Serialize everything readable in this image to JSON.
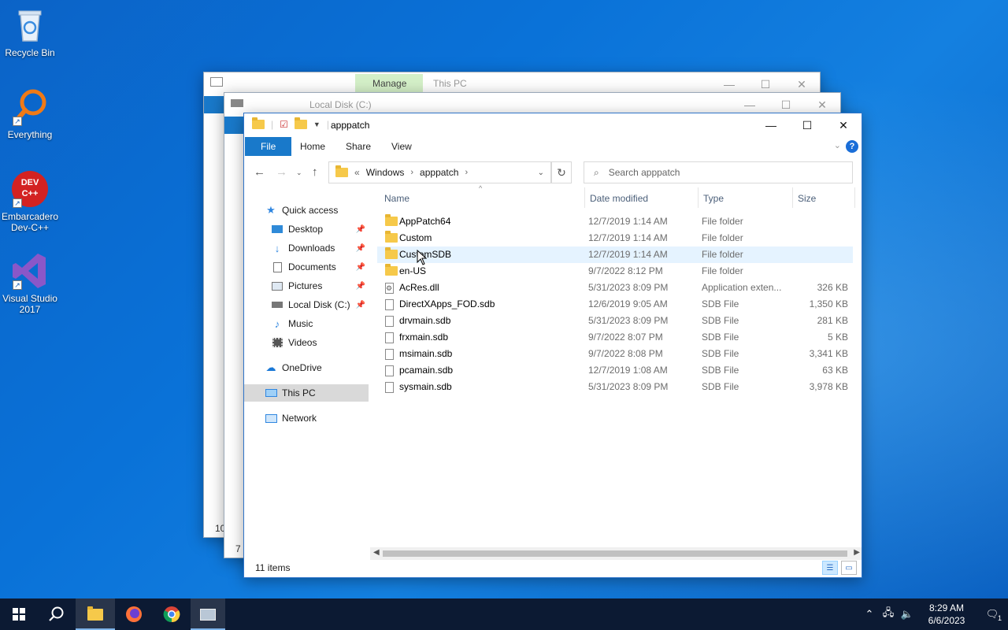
{
  "desktop": {
    "icons": [
      {
        "label": "Recycle Bin"
      },
      {
        "label": "Everything"
      },
      {
        "label": "Embarcadero Dev-C++",
        "art_text": "DEV C++"
      },
      {
        "label": "Visual Studio 2017"
      }
    ]
  },
  "back_window_1": {
    "manage_tab": "Manage",
    "title": "This PC",
    "status_fragment": "10"
  },
  "back_window_2": {
    "title": "Local Disk (C:)",
    "status_fragment": "7 i"
  },
  "window": {
    "title": "apppatch",
    "ribbon_tabs": [
      "File",
      "Home",
      "Share",
      "View"
    ],
    "address": {
      "overflow": "«",
      "crumbs": [
        "Windows",
        "apppatch"
      ]
    },
    "search_placeholder": "Search apppatch",
    "nav": [
      {
        "label": "Quick access",
        "icon": "star-icon"
      },
      {
        "label": "Desktop",
        "icon": "desktop-icon",
        "pinned": true
      },
      {
        "label": "Downloads",
        "icon": "download-icon",
        "pinned": true
      },
      {
        "label": "Documents",
        "icon": "documents-icon",
        "pinned": true
      },
      {
        "label": "Pictures",
        "icon": "pictures-icon",
        "pinned": true
      },
      {
        "label": "Local Disk (C:)",
        "icon": "drive-icon",
        "pinned": true
      },
      {
        "label": "Music",
        "icon": "music-icon"
      },
      {
        "label": "Videos",
        "icon": "videos-icon"
      },
      {
        "label": "OneDrive",
        "icon": "cloud-icon"
      },
      {
        "label": "This PC",
        "icon": "computer-icon",
        "selected": true
      },
      {
        "label": "Network",
        "icon": "network-icon"
      }
    ],
    "columns": [
      "Name",
      "Date modified",
      "Type",
      "Size"
    ],
    "files": [
      {
        "name": "AppPatch64",
        "date": "12/7/2019 1:14 AM",
        "type": "File folder",
        "size": "",
        "kind": "folder"
      },
      {
        "name": "Custom",
        "date": "12/7/2019 1:14 AM",
        "type": "File folder",
        "size": "",
        "kind": "folder"
      },
      {
        "name": "CustomSDB",
        "date": "12/7/2019 1:14 AM",
        "type": "File folder",
        "size": "",
        "kind": "folder"
      },
      {
        "name": "en-US",
        "date": "9/7/2022 8:12 PM",
        "type": "File folder",
        "size": "",
        "kind": "folder"
      },
      {
        "name": "AcRes.dll",
        "date": "5/31/2023 8:09 PM",
        "type": "Application exten...",
        "size": "326 KB",
        "kind": "dll"
      },
      {
        "name": "DirectXApps_FOD.sdb",
        "date": "12/6/2019 9:05 AM",
        "type": "SDB File",
        "size": "1,350 KB",
        "kind": "file"
      },
      {
        "name": "drvmain.sdb",
        "date": "5/31/2023 8:09 PM",
        "type": "SDB File",
        "size": "281 KB",
        "kind": "file"
      },
      {
        "name": "frxmain.sdb",
        "date": "9/7/2022 8:07 PM",
        "type": "SDB File",
        "size": "5 KB",
        "kind": "file"
      },
      {
        "name": "msimain.sdb",
        "date": "9/7/2022 8:08 PM",
        "type": "SDB File",
        "size": "3,341 KB",
        "kind": "file"
      },
      {
        "name": "pcamain.sdb",
        "date": "12/7/2019 1:08 AM",
        "type": "SDB File",
        "size": "63 KB",
        "kind": "file"
      },
      {
        "name": "sysmain.sdb",
        "date": "5/31/2023 8:09 PM",
        "type": "SDB File",
        "size": "3,978 KB",
        "kind": "file"
      }
    ],
    "status": "11 items"
  },
  "taskbar": {
    "time": "8:29 AM",
    "date": "6/6/2023",
    "notification_count": "1"
  },
  "colors": {
    "accent": "#1979ca",
    "hover_row": "#e5f3ff",
    "taskbar": "#0c1a33"
  }
}
